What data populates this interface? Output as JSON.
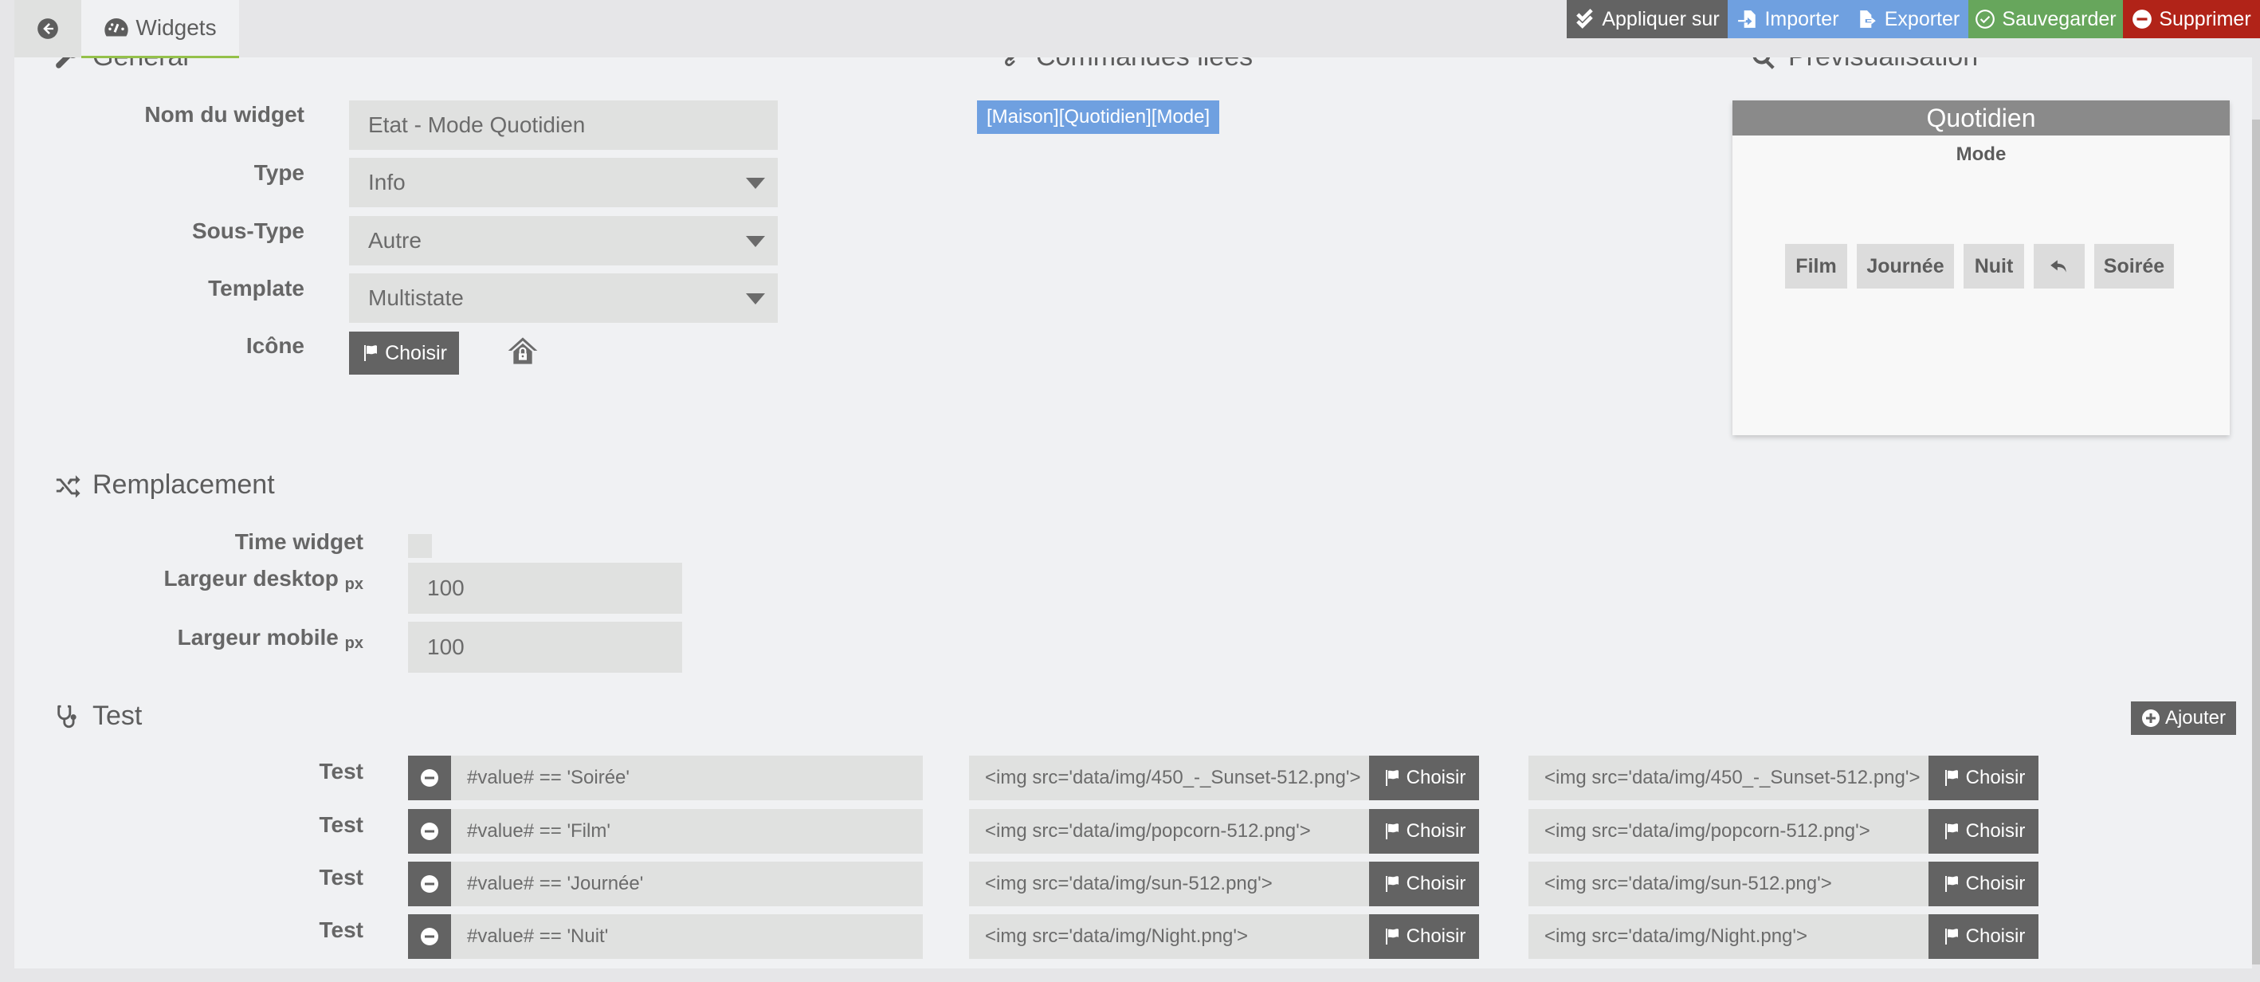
{
  "topbar": {
    "tab_widgets": "Widgets",
    "actions": {
      "apply": "Appliquer sur",
      "import": "Importer",
      "export": "Exporter",
      "save": "Sauvegarder",
      "delete": "Supprimer"
    },
    "colors": {
      "apply": "#636363",
      "import_export": "#6fa0e0",
      "save": "#67a65c",
      "delete": "#b12318",
      "tab_underline": "#94c14a"
    }
  },
  "general": {
    "title": "Général",
    "fields": {
      "name_label": "Nom du widget",
      "name_value": "Etat - Mode Quotidien",
      "type_label": "Type",
      "type_value": "Info",
      "subtype_label": "Sous-Type",
      "subtype_value": "Autre",
      "template_label": "Template",
      "template_value": "Multistate",
      "icon_label": "Icône",
      "icon_button": "Choisir"
    }
  },
  "commands": {
    "title": "Commandes liées",
    "items": [
      "[Maison][Quotidien][Mode]"
    ]
  },
  "preview": {
    "title": "Prévisualisation",
    "card_title": "Quotidien",
    "card_subtitle": "Mode",
    "buttons": [
      "Film",
      "Journée",
      "Nuit",
      "undo-icon",
      "Soirée"
    ]
  },
  "replacement": {
    "title": "Remplacement",
    "time_widget_label": "Time widget",
    "time_widget_checked": false,
    "desktop_label": "Largeur desktop",
    "desktop_unit": "px",
    "desktop_value": "100",
    "mobile_label": "Largeur mobile",
    "mobile_unit": "px",
    "mobile_value": "100"
  },
  "test": {
    "title": "Test",
    "add_button": "Ajouter",
    "choose_label": "Choisir",
    "rows": [
      {
        "label": "Test",
        "condition": "#value# == 'Soirée'",
        "display1": "<img src='data/img/450_-_Sunset-512.png'>",
        "display2": "<img src='data/img/450_-_Sunset-512.png'>"
      },
      {
        "label": "Test",
        "condition": "#value# == 'Film'",
        "display1": "<img src='data/img/popcorn-512.png'>",
        "display2": "<img src='data/img/popcorn-512.png'>"
      },
      {
        "label": "Test",
        "condition": "#value# == 'Journée'",
        "display1": "<img src='data/img/sun-512.png'>",
        "display2": "<img src='data/img/sun-512.png'>"
      },
      {
        "label": "Test",
        "condition": "#value# == 'Nuit'",
        "display1": "<img src='data/img/Night.png'>",
        "display2": "<img src='data/img/Night.png'>"
      }
    ]
  }
}
